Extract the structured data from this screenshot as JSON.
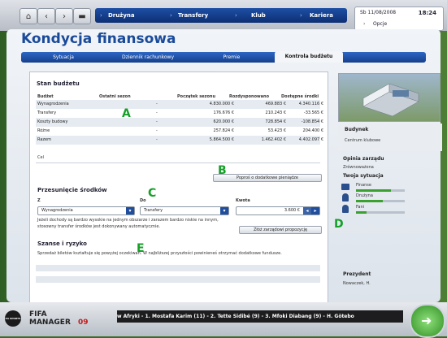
{
  "menu": {
    "items": [
      "Drużyna",
      "Transfery",
      "Klub",
      "Kariera"
    ]
  },
  "date": {
    "text": "Sb 11/08/2008",
    "time": "18:24",
    "options": "Opcje"
  },
  "page": {
    "title": "Kondycja finansowa"
  },
  "tabs": [
    "Sytuacja",
    "Dziennik rachunkowy",
    "Premie",
    "Kontrola budżetu"
  ],
  "budget": {
    "title": "Stan budżetu",
    "headers": [
      "Budżet",
      "Ostatni sezon",
      "Początek sezonu",
      "Rozdysponowano",
      "Dostępne środki"
    ],
    "rows": [
      [
        "Wynagrodzenia",
        "-",
        "4.830.000 €",
        "469.883 €",
        "4.340.116 €"
      ],
      [
        "Transfery",
        "-",
        "176.676 €",
        "210.243 €",
        "-33.565 €"
      ],
      [
        "Koszty budowy",
        "-",
        "620.000 €",
        "728.854 €",
        "-108.854 €"
      ],
      [
        "Różne",
        "-",
        "257.824 €",
        "53.423 €",
        "204.400 €"
      ],
      [
        "Razem",
        "-",
        "5.864.500 €",
        "1.462.402 €",
        "4.402.097 €"
      ]
    ],
    "goal_label": "Cel",
    "request_button": "Poproś o dodatkowe pieniądze"
  },
  "transfer": {
    "title": "Przesunięcie środków",
    "from_label": "Z",
    "from_value": "Wynagrodzenia",
    "to_label": "Do",
    "to_value": "Transfery",
    "amount_label": "Kwota",
    "amount_value": "3.600 €",
    "note": "Jeżeli dochody są bardzo wysokie na jednym obszarze i zarazem bardzo niskie na innym, stosowny transfer środków jest dokonywany automatycznie.",
    "submit_button": "Złóż zarządowi propozycję"
  },
  "risk": {
    "title": "Szanse i ryzyko",
    "text": "Sprzedaż biletów kształtuje się powyżej oczekiwań. W najbliższej przyszłości powinieneś otrzymać dodatkowe fundusze."
  },
  "markers": [
    "A",
    "B",
    "C",
    "D",
    "E"
  ],
  "side": {
    "building_label": "Budynek",
    "building_value": "Centrum klubowe",
    "opinion_label": "Opinia zarządu",
    "opinion_value": "Zrównoważona",
    "situation_label": "Twoja sytuacja",
    "meters": [
      {
        "label": "Finanse",
        "level": 0.72
      },
      {
        "label": "Drużyna",
        "level": 0.55
      },
      {
        "label": "Fani",
        "level": 0.22
      }
    ],
    "president_label": "Prezydent",
    "president_value": "Nowaczek, H."
  },
  "ticker": {
    "text": "w Afryki - 1. Mostafa Karim (11) - 2. Tette Sidibé (9) - 3. Mfoki Diabang (9) - H. Götebo"
  },
  "logo": {
    "ea": "EA SPORTS",
    "fifa": "FIFA",
    "manager": "MANAGER",
    "year": "09"
  },
  "colors": {
    "accent": "#1a4a9a",
    "marker": "#14a028",
    "meter": "#3aa030"
  }
}
